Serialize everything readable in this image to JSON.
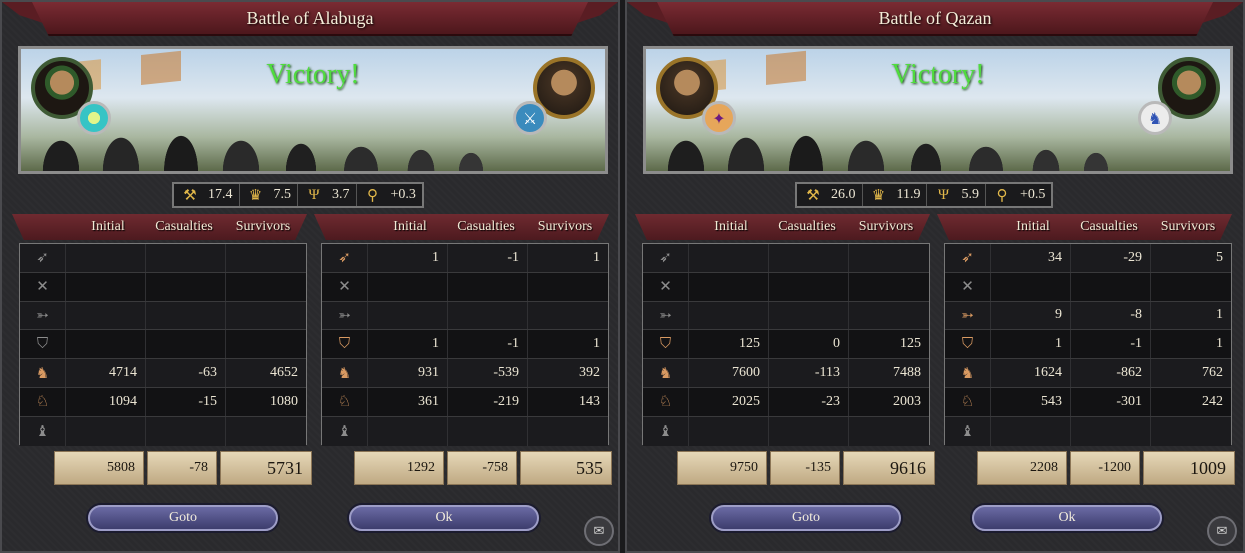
{
  "battles": [
    {
      "title": "Battle of Alabuga",
      "result": "Victory!",
      "left_badge": "gem-emblem-icon",
      "right_badge": "crossed-swords-icon",
      "stats": [
        {
          "icon": "siege-icon",
          "value": "17.4"
        },
        {
          "icon": "crown-icon",
          "value": "7.5"
        },
        {
          "icon": "candelabra-icon",
          "value": "3.7"
        },
        {
          "icon": "magnifier-icon",
          "value": "+0.3"
        }
      ],
      "sides": [
        {
          "headers": {
            "initial": "Initial",
            "casualties": "Casualties",
            "survivors": "Survivors"
          },
          "rows": [
            {
              "icon": "archer-icon",
              "initial": "",
              "casualties": "",
              "survivors": ""
            },
            {
              "icon": "pikemen-icon",
              "initial": "",
              "casualties": "",
              "survivors": ""
            },
            {
              "icon": "bow-icon",
              "initial": "",
              "casualties": "",
              "survivors": ""
            },
            {
              "icon": "shield-sword-icon",
              "initial": "",
              "casualties": "",
              "survivors": ""
            },
            {
              "icon": "heavy-cavalry-icon",
              "initial": "4714",
              "casualties": "-63",
              "survivors": "4652"
            },
            {
              "icon": "light-cavalry-icon",
              "initial": "1094",
              "casualties": "-15",
              "survivors": "1080"
            },
            {
              "icon": "camel-icon",
              "initial": "",
              "casualties": "",
              "survivors": ""
            }
          ],
          "totals": {
            "initial": "5808",
            "casualties": "-78",
            "survivors": "5731"
          }
        },
        {
          "headers": {
            "initial": "Initial",
            "casualties": "Casualties",
            "survivors": "Survivors"
          },
          "rows": [
            {
              "icon": "archer-icon",
              "initial": "1",
              "casualties": "-1",
              "survivors": "1"
            },
            {
              "icon": "pikemen-icon",
              "initial": "",
              "casualties": "",
              "survivors": ""
            },
            {
              "icon": "bow-icon",
              "initial": "",
              "casualties": "",
              "survivors": ""
            },
            {
              "icon": "shield-sword-icon",
              "initial": "1",
              "casualties": "-1",
              "survivors": "1"
            },
            {
              "icon": "heavy-cavalry-icon",
              "initial": "931",
              "casualties": "-539",
              "survivors": "392"
            },
            {
              "icon": "light-cavalry-icon",
              "initial": "361",
              "casualties": "-219",
              "survivors": "143"
            },
            {
              "icon": "camel-icon",
              "initial": "",
              "casualties": "",
              "survivors": ""
            }
          ],
          "totals": {
            "initial": "1292",
            "casualties": "-758",
            "survivors": "535"
          }
        }
      ],
      "buttons": {
        "goto": "Goto",
        "ok": "Ok"
      }
    },
    {
      "title": "Battle of Qazan",
      "result": "Victory!",
      "left_badge": "purple-emblem-icon",
      "right_badge": "horse-icon",
      "stats": [
        {
          "icon": "siege-icon",
          "value": "26.0"
        },
        {
          "icon": "crown-icon",
          "value": "11.9"
        },
        {
          "icon": "candelabra-icon",
          "value": "5.9"
        },
        {
          "icon": "magnifier-icon",
          "value": "+0.5"
        }
      ],
      "sides": [
        {
          "headers": {
            "initial": "Initial",
            "casualties": "Casualties",
            "survivors": "Survivors"
          },
          "rows": [
            {
              "icon": "archer-icon",
              "initial": "",
              "casualties": "",
              "survivors": ""
            },
            {
              "icon": "pikemen-icon",
              "initial": "",
              "casualties": "",
              "survivors": ""
            },
            {
              "icon": "bow-icon",
              "initial": "",
              "casualties": "",
              "survivors": ""
            },
            {
              "icon": "shield-sword-icon",
              "initial": "125",
              "casualties": "0",
              "survivors": "125"
            },
            {
              "icon": "heavy-cavalry-icon",
              "initial": "7600",
              "casualties": "-113",
              "survivors": "7488"
            },
            {
              "icon": "light-cavalry-icon",
              "initial": "2025",
              "casualties": "-23",
              "survivors": "2003"
            },
            {
              "icon": "camel-icon",
              "initial": "",
              "casualties": "",
              "survivors": ""
            }
          ],
          "totals": {
            "initial": "9750",
            "casualties": "-135",
            "survivors": "9616"
          }
        },
        {
          "headers": {
            "initial": "Initial",
            "casualties": "Casualties",
            "survivors": "Survivors"
          },
          "rows": [
            {
              "icon": "archer-icon",
              "initial": "34",
              "casualties": "-29",
              "survivors": "5"
            },
            {
              "icon": "pikemen-icon",
              "initial": "",
              "casualties": "",
              "survivors": ""
            },
            {
              "icon": "bow-icon",
              "initial": "9",
              "casualties": "-8",
              "survivors": "1"
            },
            {
              "icon": "shield-sword-icon",
              "initial": "1",
              "casualties": "-1",
              "survivors": "1"
            },
            {
              "icon": "heavy-cavalry-icon",
              "initial": "1624",
              "casualties": "-862",
              "survivors": "762"
            },
            {
              "icon": "light-cavalry-icon",
              "initial": "543",
              "casualties": "-301",
              "survivors": "242"
            },
            {
              "icon": "camel-icon",
              "initial": "",
              "casualties": "",
              "survivors": ""
            }
          ],
          "totals": {
            "initial": "2208",
            "casualties": "-1200",
            "survivors": "1009"
          }
        }
      ],
      "buttons": {
        "goto": "Goto",
        "ok": "Ok"
      }
    }
  ]
}
